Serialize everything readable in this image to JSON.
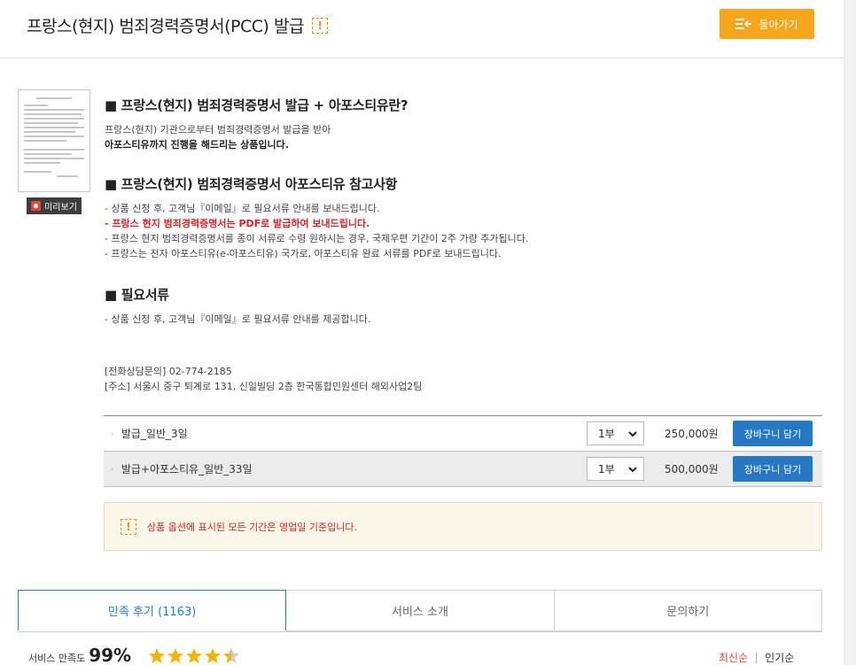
{
  "header": {
    "title": "프랑스(현지) 범죄경력증명서(PCC) 발급",
    "back_label": "돌아가기",
    "warn_glyph": "!"
  },
  "preview": {
    "label": "미리보기"
  },
  "section1": {
    "title": "■ 프랑스(현지) 범죄경력증명서 발급 + 아포스티유란?",
    "line1": "프랑스(현지) 기관으로부터 범죄경력증명서 발급을 받아",
    "line2": "아포스티유까지 진행을 해드리는 상품입니다."
  },
  "section2": {
    "title": "■ 프랑스(현지) 범죄경력증명서 아포스티유 참고사항",
    "lines": [
      "- 상품 신청 후, 고객님『이메일』로 필요서류 안내를 보내드립니다.",
      "- 프랑스 현지 범죄경력증명서는 PDF로 발급하여 보내드립니다.",
      "- 프랑스 현지 범죄경력증명서를 종이 서류로 수령 원하시는 경우, 국제우편 기간이 2주 가량 추가됩니다.",
      "- 프랑스는 전자 아포스티유(e-아포스티유) 국가로, 아포스티유 완료 서류를 PDF로 보내드립니다."
    ]
  },
  "section3": {
    "title": "■ 필요서류",
    "line1": "- 상품 신청 후, 고객님『이메일』로 필요서류 안내를 제공합니다."
  },
  "contact": {
    "phone": "[전화상담문의] 02-774-2185",
    "address": "[주소] 서울시 중구 퇴계로 131, 신일빌딩 2층 한국통합민원센터 해외사업2팀"
  },
  "options": [
    {
      "name": "발급_일반_3일",
      "qty": "1부",
      "price": "250,000원",
      "cart": "장바구니 담기"
    },
    {
      "name": "발급+아포스티유_일반_33일",
      "qty": "1부",
      "price": "500,000원",
      "cart": "장바구니 담기"
    }
  ],
  "notice": {
    "text": "상품 옵션에 표시된 모든 기간은 영업일 기준입니다."
  },
  "tabs": [
    {
      "label": "만족 후기 (1163)"
    },
    {
      "label": "서비스 소개"
    },
    {
      "label": "문의하기"
    }
  ],
  "rating": {
    "label": "서비스 만족도",
    "percent": "99%",
    "stars_value": 4.5,
    "stars_max": 5
  },
  "sort": {
    "latest": "최신순",
    "popular": "인기순"
  },
  "colors": {
    "accent": "#f7a51b",
    "cart": "#2578c4",
    "tab_active": "#1f7fd0",
    "alert": "#e02020",
    "star": "#f5b400"
  }
}
